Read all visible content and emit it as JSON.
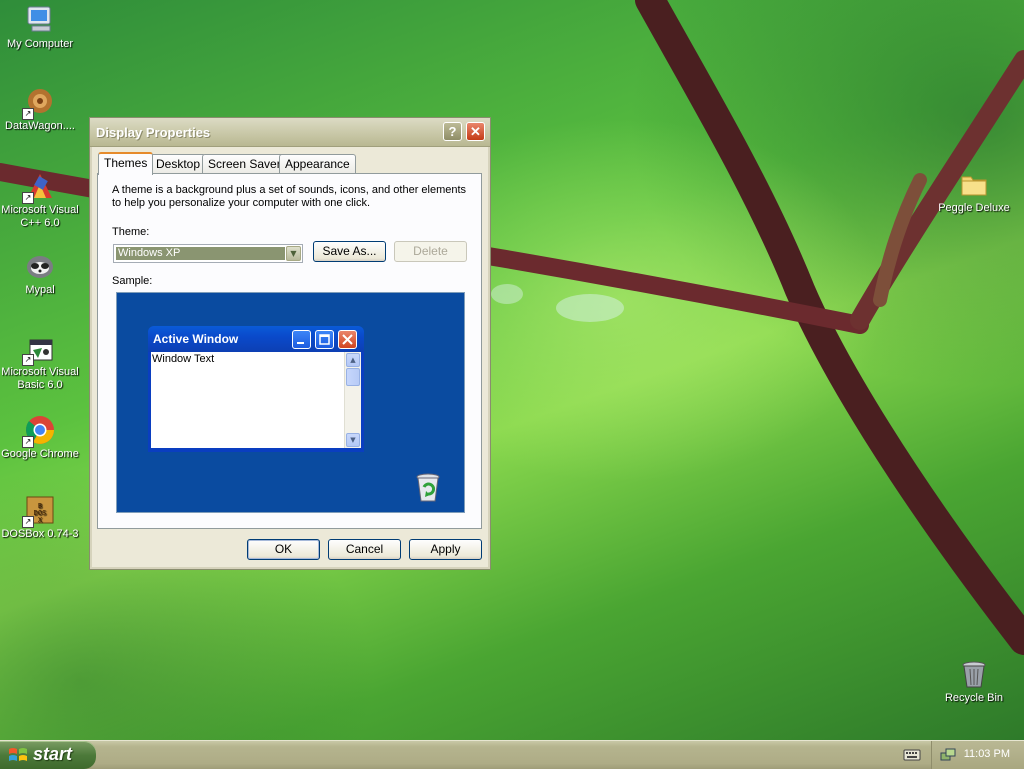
{
  "desktop": {
    "icons": [
      {
        "label": "My Computer",
        "icon": "my-computer-icon"
      },
      {
        "label": "DataWagon....",
        "icon": "datawagon-icon"
      },
      {
        "label": "Microsoft Visual C++ 6.0",
        "icon": "visual-cpp-icon"
      },
      {
        "label": "Mypal",
        "icon": "mypal-icon"
      },
      {
        "label": "Microsoft Visual Basic 6.0",
        "icon": "visual-basic-icon"
      },
      {
        "label": "Google Chrome",
        "icon": "chrome-icon"
      },
      {
        "label": "DOSBox 0.74-3",
        "icon": "dosbox-icon"
      },
      {
        "label": "Peggle Deluxe",
        "icon": "folder-icon"
      },
      {
        "label": "Recycle Bin",
        "icon": "recycle-bin-icon"
      }
    ]
  },
  "dialog": {
    "title": "Display Properties",
    "help_glyph": "?",
    "close_glyph": "✕",
    "tabs": [
      "Themes",
      "Desktop",
      "Screen Saver",
      "Appearance"
    ],
    "active_tab": "Themes",
    "description": "A theme is a background plus a set of sounds, icons, and other elements to help you personalize your computer with one click.",
    "theme_label": "Theme:",
    "theme_value": "Windows XP",
    "save_as_label": "Save As...",
    "delete_label": "Delete",
    "sample_label": "Sample:",
    "sample": {
      "window_title": "Active Window",
      "window_text": "Window Text"
    },
    "ok_label": "OK",
    "cancel_label": "Cancel",
    "apply_label": "Apply"
  },
  "taskbar": {
    "start_label": "start",
    "clock": "11:03 PM"
  },
  "colors": {
    "sample_desktop": "#0a4ba0",
    "title_active": "#0a4acb",
    "tab_highlight": "#e68b2c"
  }
}
